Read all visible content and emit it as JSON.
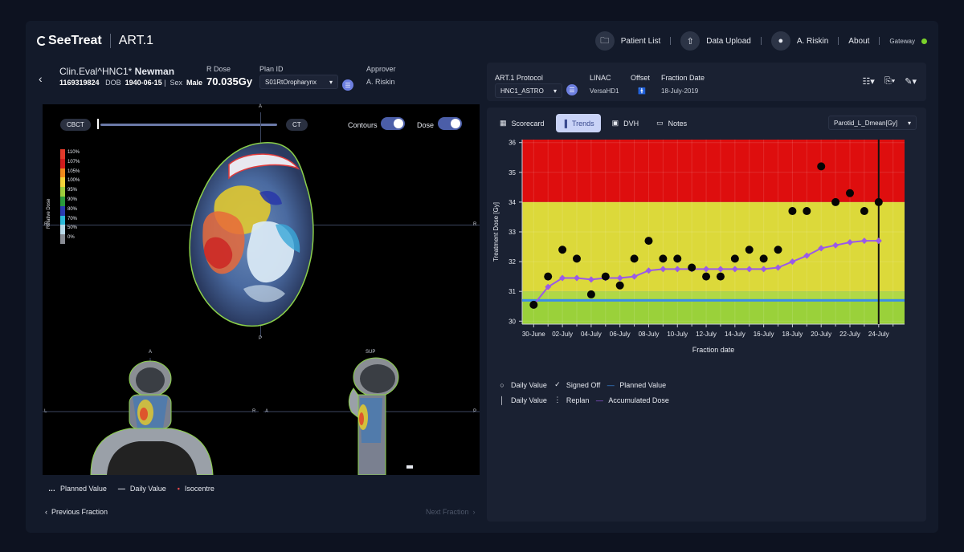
{
  "app": {
    "brand": "SeeTreat",
    "product": "ART.1"
  },
  "nav": {
    "patient_list": "Patient List",
    "data_upload": "Data Upload",
    "user": "A. Riskin",
    "about": "About",
    "gateway": "Gateway",
    "gateway_status_color": "#7ad12b"
  },
  "patient": {
    "name_prefix": "Clin.Eval^HNC1*",
    "name_last": "Newman",
    "id": "1169319824",
    "dob_label": "DOB",
    "dob": "1940-06-15",
    "sex_label": "Sex",
    "sex": "Male",
    "rdose_label": "R Dose",
    "rdose": "70.035Gy",
    "plan_label": "Plan ID",
    "plan": "S01RtOropharynx",
    "approver_label": "Approver",
    "approver": "A. Riskin"
  },
  "viewer": {
    "cbct": "CBCT",
    "ct": "CT",
    "contours_label": "Contours",
    "dose_label": "Dose",
    "contours_on": true,
    "dose_on": true,
    "relative_dose_title": "Relative Dose",
    "dose_levels": [
      "110%",
      "107%",
      "105%",
      "100%",
      "95%",
      "90%",
      "80%",
      "70%",
      "50%",
      "0%"
    ],
    "dose_colors": [
      "#e03a2a",
      "#d01c1c",
      "#f08a1c",
      "#f2d23a",
      "#9ccc3c",
      "#2a9a3c",
      "#2a3ab0",
      "#2ab8d8",
      "#b8d8e8",
      "#888c94"
    ],
    "orient_main": {
      "top": "A",
      "bottom": "P",
      "left": "R",
      "right": "R"
    },
    "orient_coronal": {
      "top": "A",
      "left": "L",
      "right": "R"
    },
    "orient_sagittal": {
      "top": "SUP",
      "left": "A",
      "right": "P"
    },
    "legend": {
      "planned": "Planned Value",
      "daily": "Daily Value",
      "isocentre": "Isocentre"
    },
    "prev_fraction": "Previous Fraction",
    "next_fraction": "Next Fraction"
  },
  "right_top": {
    "protocol_label": "ART.1 Protocol",
    "protocol": "HNC1_ASTRO",
    "linac_label": "LINAC",
    "linac": "VersaHD1",
    "offset_label": "Offset",
    "fraction_date_label": "Fraction Date",
    "fraction_date": "18-July-2019"
  },
  "tabs": [
    {
      "label": "Scorecard",
      "icon": "calendar-icon",
      "active": false
    },
    {
      "label": "Trends",
      "icon": "bar-chart-icon",
      "active": true
    },
    {
      "label": "DVH",
      "icon": "image-icon",
      "active": false
    },
    {
      "label": "Notes",
      "icon": "comment-icon",
      "active": false
    }
  ],
  "metric_select": "Parotid_L_Dmean[Gy]",
  "chart_legend": {
    "daily_value": "Daily Value",
    "signed_off": "Signed Off",
    "planned_value": "Planned Value",
    "daily_value2": "Daily Value",
    "replan": "Replan",
    "accumulated": "Accumulated Dose",
    "planned_color": "#3a8ee8",
    "accumulated_color": "#9a5ae8"
  },
  "chart_data": {
    "type": "scatter",
    "xlabel": "Fraction date",
    "ylabel": "Treatment Dose [Gy]",
    "ylim": [
      29.9,
      36.1
    ],
    "yticks": [
      30,
      31,
      32,
      33,
      34,
      35,
      36
    ],
    "xticks": [
      "30-June",
      "02-July",
      "04-July",
      "06-July",
      "08-July",
      "10-July",
      "12-July",
      "14-July",
      "16-July",
      "18-July",
      "20-July",
      "22-July",
      "24-July"
    ],
    "bands": [
      {
        "from": 34,
        "to": 36.1,
        "color": "#de0e0e"
      },
      {
        "from": 31,
        "to": 34,
        "color": "#dcd93a"
      },
      {
        "from": 29.9,
        "to": 31,
        "color": "#9ad13a"
      }
    ],
    "planned_value": 30.7,
    "replan_day": 24,
    "series": [
      {
        "name": "Daily Value",
        "points": [
          [
            0,
            30.55
          ],
          [
            1,
            31.5
          ],
          [
            2,
            32.4
          ],
          [
            3,
            32.1
          ],
          [
            4,
            30.9
          ],
          [
            5,
            31.5
          ],
          [
            6,
            31.2
          ],
          [
            7,
            32.1
          ],
          [
            8,
            32.7
          ],
          [
            9,
            32.1
          ],
          [
            10,
            32.1
          ],
          [
            11,
            31.8
          ],
          [
            12,
            31.5
          ],
          [
            13,
            31.5
          ],
          [
            14,
            32.1
          ],
          [
            15,
            32.4
          ],
          [
            16,
            32.1
          ],
          [
            17,
            32.4
          ],
          [
            18,
            33.7
          ],
          [
            19,
            33.7
          ],
          [
            20,
            35.2
          ],
          [
            21,
            34.0
          ],
          [
            22,
            34.3
          ],
          [
            23,
            33.7
          ],
          [
            24,
            34.0
          ]
        ]
      },
      {
        "name": "Accumulated Dose",
        "points": [
          [
            0,
            30.55
          ],
          [
            1,
            31.15
          ],
          [
            2,
            31.45
          ],
          [
            3,
            31.45
          ],
          [
            4,
            31.4
          ],
          [
            5,
            31.45
          ],
          [
            6,
            31.45
          ],
          [
            7,
            31.5
          ],
          [
            8,
            31.7
          ],
          [
            9,
            31.75
          ],
          [
            10,
            31.75
          ],
          [
            11,
            31.75
          ],
          [
            12,
            31.75
          ],
          [
            13,
            31.75
          ],
          [
            14,
            31.75
          ],
          [
            15,
            31.75
          ],
          [
            16,
            31.75
          ],
          [
            17,
            31.8
          ],
          [
            18,
            32.0
          ],
          [
            19,
            32.2
          ],
          [
            20,
            32.45
          ],
          [
            21,
            32.55
          ],
          [
            22,
            32.65
          ],
          [
            23,
            32.7
          ],
          [
            24,
            32.7
          ]
        ]
      }
    ]
  }
}
